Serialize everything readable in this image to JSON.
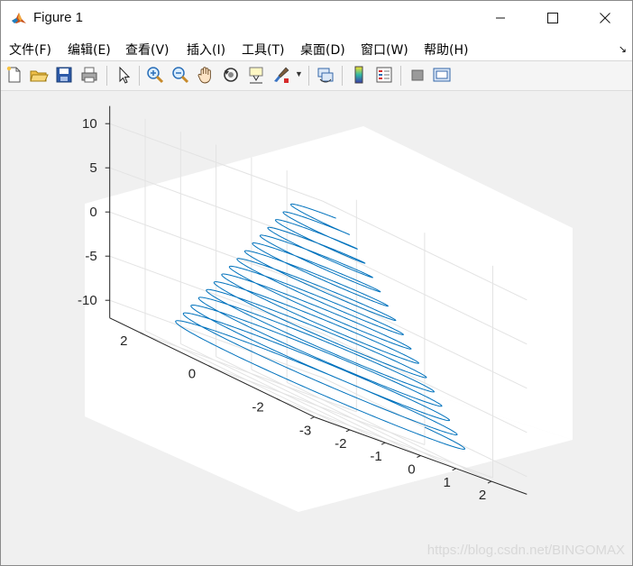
{
  "window": {
    "title": "Figure 1",
    "controls": {
      "minimize": "minimize",
      "maximize": "maximize",
      "close": "close"
    }
  },
  "menu": {
    "items": [
      "文件(F)",
      "编辑(E)",
      "查看(V)",
      "插入(I)",
      "工具(T)",
      "桌面(D)",
      "窗口(W)",
      "帮助(H)"
    ]
  },
  "toolbar": {
    "icons": [
      "new-figure-icon",
      "open-file-icon",
      "save-icon",
      "print-icon",
      "pointer-icon",
      "zoom-in-icon",
      "zoom-out-icon",
      "pan-hand-icon",
      "rotate-3d-icon",
      "data-cursor-icon",
      "brush-icon",
      "link-plot-icon",
      "colorbar-icon",
      "legend-icon",
      "hide-plot-tools-icon",
      "show-plot-tools-icon"
    ]
  },
  "colors": {
    "line": "#0072BD",
    "axes_bg": "#ffffff",
    "figure_bg": "#f0f0f0",
    "grid": "#e3e3e3"
  },
  "chart_data": {
    "type": "line",
    "view": "3d",
    "series": [
      {
        "description": "conical spiral, radius grows as z decreases",
        "radius_at_top": 0.5,
        "radius_at_bottom": 3,
        "z_top": 10,
        "z_bottom": -10,
        "turns": 16
      }
    ],
    "xlim": [
      -3,
      3
    ],
    "ylim": [
      -3,
      3
    ],
    "zlim": [
      -12,
      12
    ],
    "xticks": [
      "-3",
      "-2",
      "-1",
      "0",
      "1",
      "2"
    ],
    "yticks": [
      "-2",
      "0",
      "2"
    ],
    "zticks": [
      "-10",
      "-5",
      "0",
      "5",
      "10"
    ],
    "grid": true
  },
  "watermark": "https://blog.csdn.net/BINGOMAX"
}
